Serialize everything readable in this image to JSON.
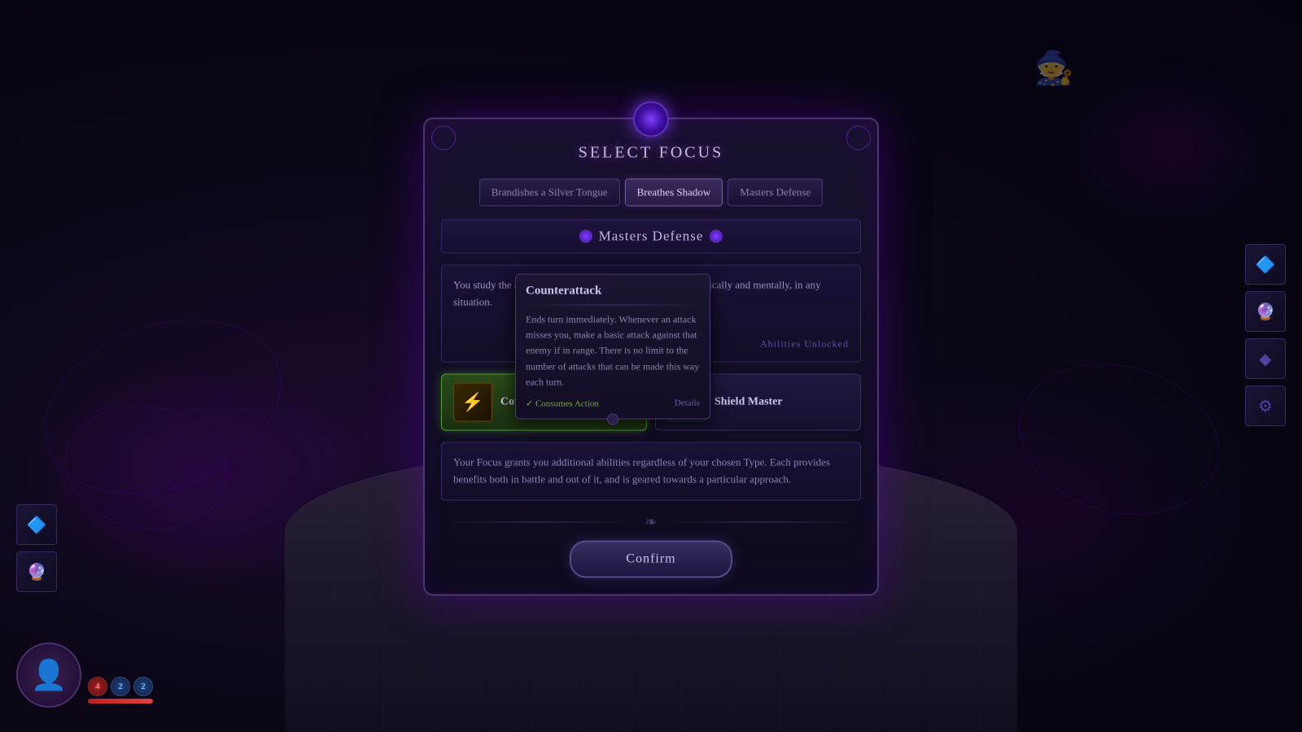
{
  "background": {
    "color": "#0a0614"
  },
  "dialog": {
    "title": "Select Focus",
    "top_gem_color": "#8040ff",
    "tabs": [
      {
        "id": "brandishes",
        "label": "Brandishes a Silver Tongue",
        "active": false
      },
      {
        "id": "breathes",
        "label": "Breathes Shadow",
        "active": false
      },
      {
        "id": "masters",
        "label": "Masters Defense",
        "active": true
      }
    ],
    "section_title": "Masters Defense",
    "description": "You study the art of how to defend yourself and others, physically and mentally, in any situation.",
    "abilities_unlocked_label": "Abilities Unlocked",
    "abilities": [
      {
        "id": "counterattack",
        "name": "Counterattack",
        "icon": "⚡",
        "selected": true
      },
      {
        "id": "shield_master",
        "name": "Shield Master",
        "icon": "🛡",
        "selected": false
      }
    ],
    "bottom_description": "Your Focus grants you additional abilities regardless of your chosen Type. Each provides benefits both in battle and out of it, and is geared towards a particular approach.",
    "confirm_button": "Confirm"
  },
  "tooltip": {
    "title": "Counterattack",
    "body": "Ends turn immediately. Whenever an attack misses you, make a basic attack against that enemy if in range. There is no limit to the number of attacks that can be made this way each turn.",
    "consumes_action": "Consumes Action",
    "details": "Details"
  },
  "sidebar_left": {
    "icons": [
      "🔷",
      "🔮"
    ]
  },
  "sidebar_right": {
    "icons": [
      "🔷",
      "🔮",
      "◆",
      "⚙"
    ]
  },
  "avatar": {
    "symbol": "👤",
    "pips": [
      {
        "label": "4",
        "type": "red"
      },
      {
        "label": "2",
        "type": "blue"
      },
      {
        "label": "2",
        "type": "blue"
      }
    ]
  }
}
